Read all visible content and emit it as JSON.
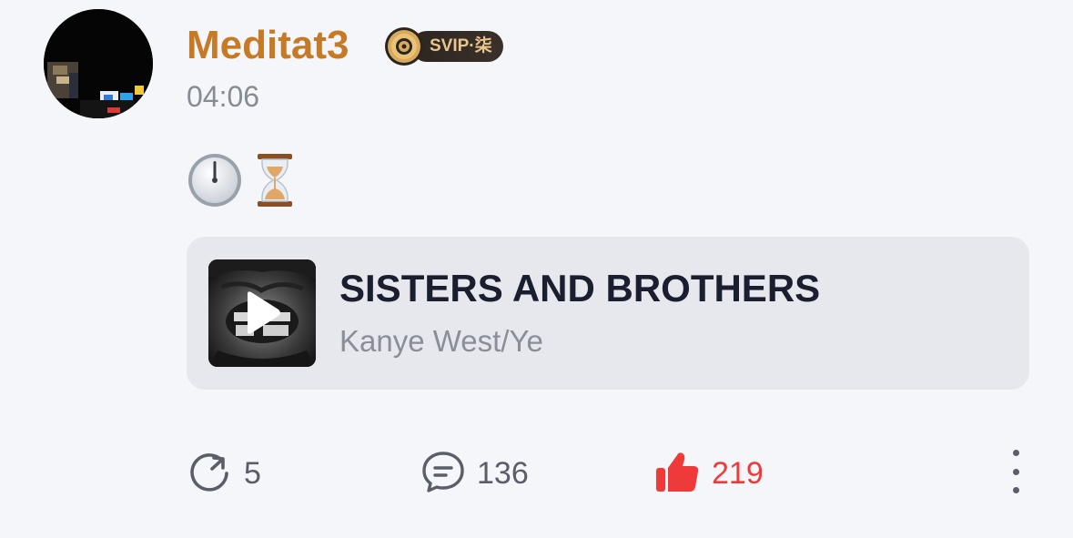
{
  "post": {
    "username": "Meditat3",
    "badge": {
      "label": "SVIP·柒",
      "icon": "vinyl-disc-icon"
    },
    "timestamp": "04:06",
    "emojis": [
      "🕛",
      "⏳"
    ]
  },
  "music_card": {
    "title": "SISTERS AND BROTHERS",
    "artist": "Kanye West/Ye",
    "cover_icon": "play-icon"
  },
  "actions": {
    "repost": {
      "icon": "repost-icon",
      "count": "5"
    },
    "comment": {
      "icon": "comment-icon",
      "count": "136"
    },
    "like": {
      "icon": "thumbs-up-icon",
      "count": "219"
    },
    "more": {
      "icon": "more-vertical-icon"
    }
  },
  "colors": {
    "username": "#c67a26",
    "like_active": "#ef3a3a",
    "background": "#f4f6fa",
    "card": "#e6e8ed"
  }
}
